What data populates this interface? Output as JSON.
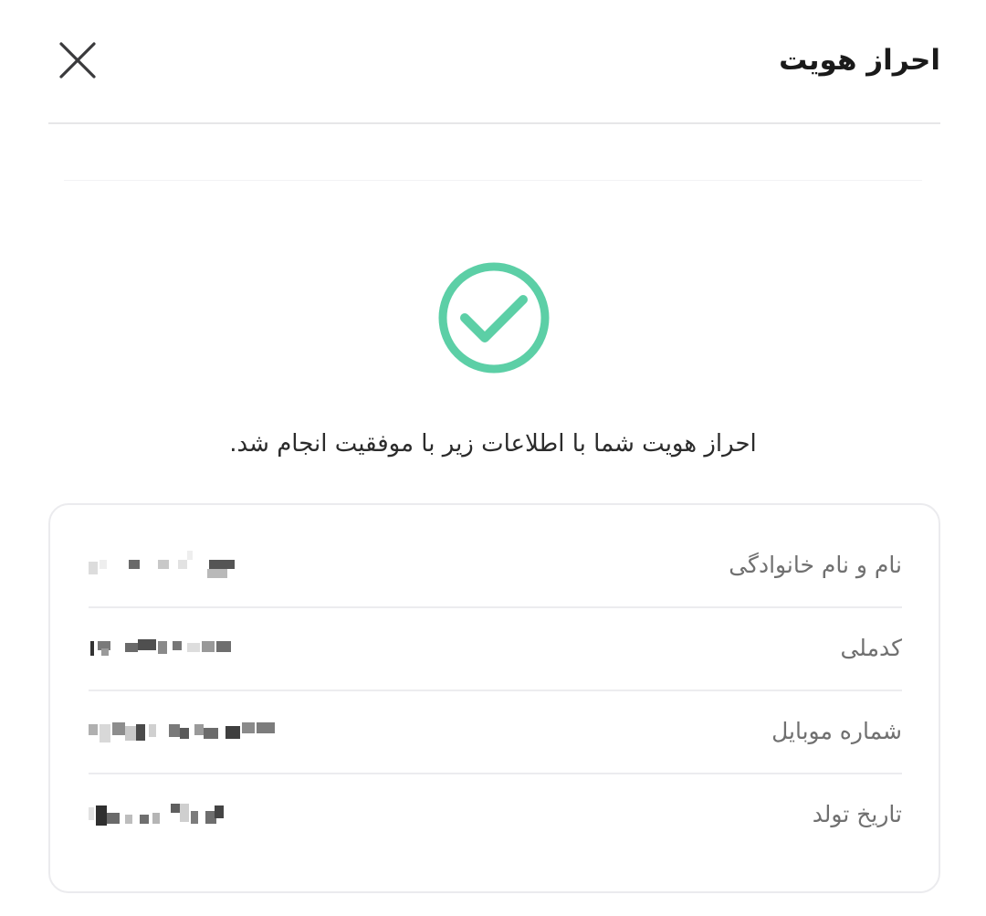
{
  "header": {
    "title": "احراز هویت",
    "close_icon": "close-icon"
  },
  "status": {
    "icon": "check-circle-icon",
    "color": "#5ccfa6",
    "message": "احراز هویت شما با اطلاعات زیر با موفقیت انجام شد."
  },
  "details": {
    "rows": [
      {
        "label": "نام و نام خانوادگی",
        "value_state": "pixelated"
      },
      {
        "label": "کدملی",
        "value_state": "pixelated"
      },
      {
        "label": "شماره موبایل",
        "value_state": "pixelated"
      },
      {
        "label": "تاریخ تولد",
        "value_state": "pixelated"
      }
    ]
  }
}
